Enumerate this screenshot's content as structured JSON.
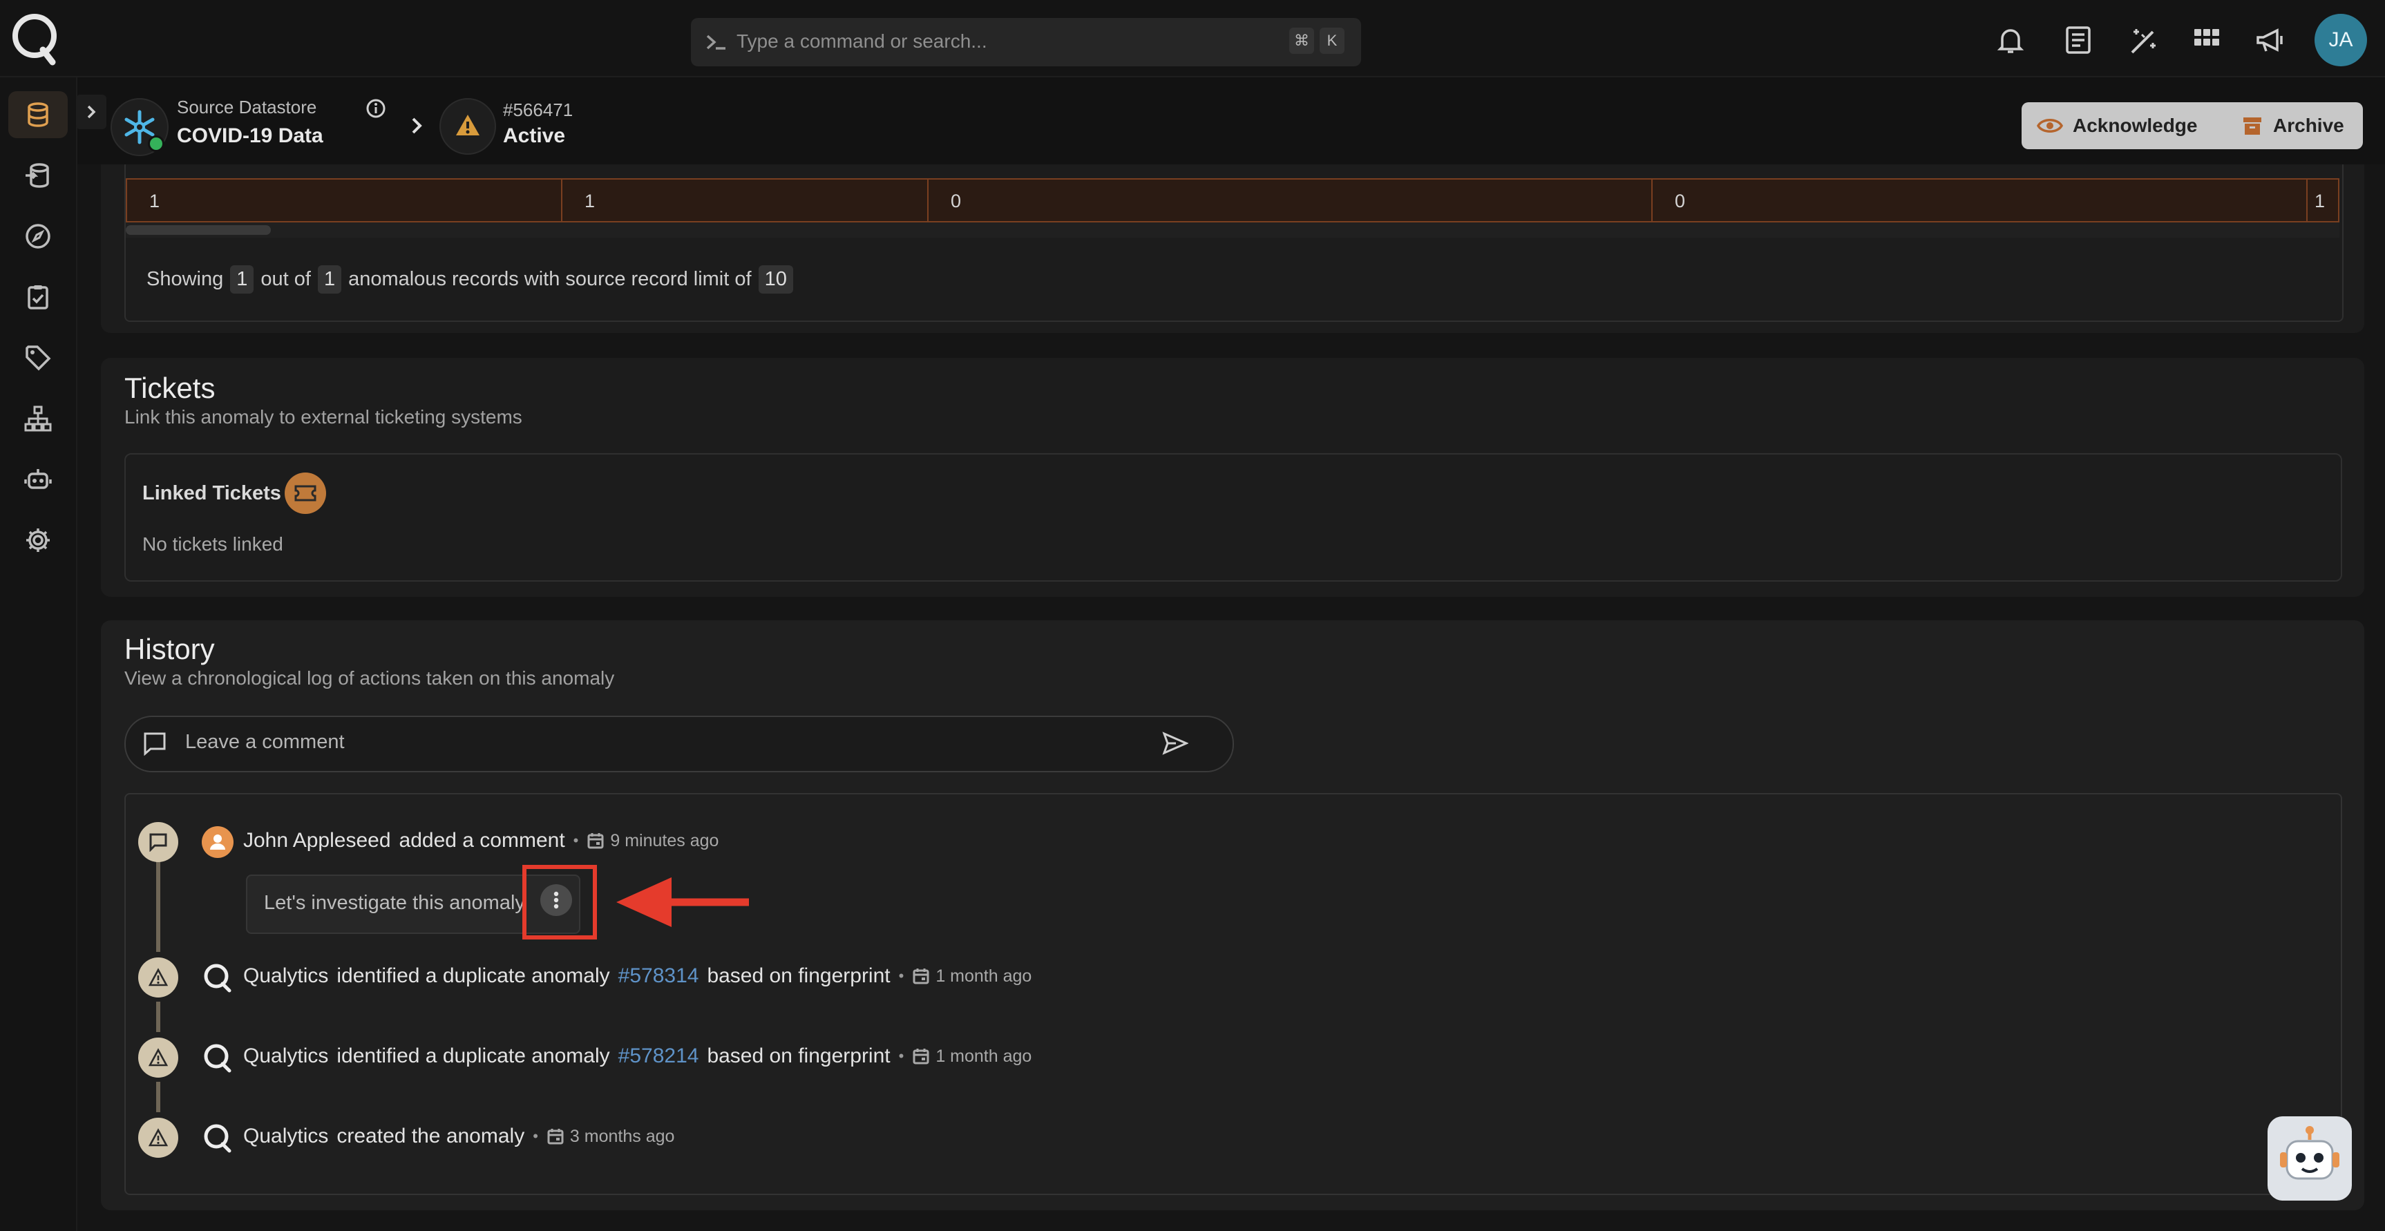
{
  "topbar": {
    "search_placeholder": "Type a command or search...",
    "shortcut_cmd": "⌘",
    "shortcut_key": "K",
    "avatar_initials": "JA",
    "accent_color": "#2e7d96"
  },
  "sidebar": {
    "items": [
      {
        "icon": "database-icon",
        "active": true
      },
      {
        "icon": "datastore-add-icon"
      },
      {
        "icon": "compass-icon"
      },
      {
        "icon": "clipboard-check-icon"
      },
      {
        "icon": "tag-icon"
      },
      {
        "icon": "hierarchy-icon"
      },
      {
        "icon": "robot-icon"
      },
      {
        "icon": "gear-icon"
      }
    ]
  },
  "header": {
    "datastore_label": "Source Datastore",
    "datastore_name": "COVID-19 Data",
    "anomaly_id": "#566471",
    "anomaly_status": "Active",
    "acknowledge_label": "Acknowledge",
    "archive_label": "Archive",
    "status_dot_color": "#35b25a"
  },
  "records": {
    "cells": [
      "1",
      "1",
      "0",
      "0",
      "1"
    ],
    "showing_prefix": "Showing",
    "showing_count": "1",
    "showing_mid": "out of",
    "showing_total": "1",
    "showing_suffix": "anomalous records with source record limit of",
    "showing_limit": "10"
  },
  "tickets": {
    "title": "Tickets",
    "subtitle": "Link this anomaly to external ticketing systems",
    "linked_label": "Linked Tickets",
    "empty_text": "No tickets linked"
  },
  "history": {
    "title": "History",
    "subtitle": "View a chronological log of actions taken on this anomaly",
    "comment_placeholder": "Leave a comment",
    "events": [
      {
        "actor": "John Appleseed",
        "text": "added a comment",
        "time": "9 minutes ago",
        "comment": "Let's investigate this anomaly"
      },
      {
        "actor": "Qualytics",
        "text": "identified a duplicate anomaly",
        "link": "#578314",
        "suffix": "based on fingerprint",
        "time": "1 month ago"
      },
      {
        "actor": "Qualytics",
        "text": "identified a duplicate anomaly",
        "link": "#578214",
        "suffix": "based on fingerprint",
        "time": "1 month ago"
      },
      {
        "actor": "Qualytics",
        "text": "created the anomaly",
        "time": "3 months ago"
      }
    ]
  },
  "annotation_color": "#e53b2c"
}
